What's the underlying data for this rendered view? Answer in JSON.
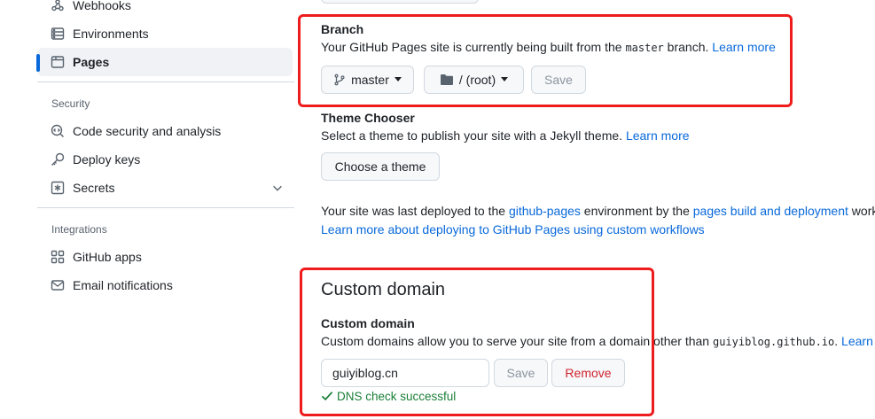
{
  "sidebar": {
    "items_top": [
      {
        "label": "Webhooks",
        "icon": "webhook-icon"
      },
      {
        "label": "Environments",
        "icon": "server-icon"
      },
      {
        "label": "Pages",
        "icon": "browser-icon",
        "active": true
      }
    ],
    "security_title": "Security",
    "security_items": [
      {
        "label": "Code security and analysis",
        "icon": "codescan-icon"
      },
      {
        "label": "Deploy keys",
        "icon": "key-icon"
      },
      {
        "label": "Secrets",
        "icon": "key-asterisk-icon"
      }
    ],
    "integrations_title": "Integrations",
    "integration_items": [
      {
        "label": "GitHub apps",
        "icon": "apps-icon"
      },
      {
        "label": "Email notifications",
        "icon": "mail-icon"
      }
    ]
  },
  "branch": {
    "title": "Branch",
    "desc_pre": "Your GitHub Pages site is currently being built from the ",
    "desc_code": "master",
    "desc_post": " branch. ",
    "learn_more": "Learn more",
    "branch_button": "master",
    "folder_button": "/ (root)",
    "save_button": "Save"
  },
  "theme": {
    "title": "Theme Chooser",
    "desc": "Select a theme to publish your site with a Jekyll theme. ",
    "learn_more": "Learn more",
    "choose_button": "Choose a theme"
  },
  "deploy": {
    "text_pre": "Your site was last deployed to the ",
    "env_link": "github-pages",
    "text_mid": " environment by the ",
    "workflow_link": "pages build and deployment",
    "text_post": " work",
    "custom_workflows_link": "Learn more about deploying to GitHub Pages using custom workflows"
  },
  "custom_domain": {
    "heading": "Custom domain",
    "label": "Custom domain",
    "desc_pre": "Custom domains allow you to serve your site from a domain other than ",
    "desc_code": "guiyiblog.github.io",
    "desc_post": ". ",
    "learn_more": "Learn m",
    "input_value": "guiyiblog.cn",
    "save_button": "Save",
    "remove_button": "Remove",
    "dns_status": "DNS check successful"
  },
  "colors": {
    "link": "#0969da",
    "success": "#1a7f37",
    "danger": "#d1242f",
    "highlight_box": "#ee1c1c"
  }
}
